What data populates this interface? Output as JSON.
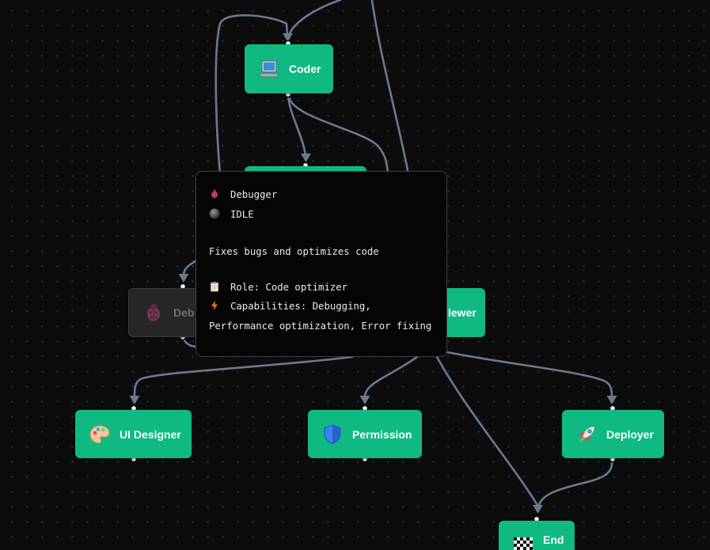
{
  "nodes": {
    "coder": {
      "label": "Coder",
      "icon": "laptop-icon"
    },
    "reviewer": {
      "label": "lewer",
      "icon": "reviewer-icon"
    },
    "debugger": {
      "label": "Deb",
      "icon": "bug-icon"
    },
    "ui_designer": {
      "label": "UI Designer",
      "icon": "palette-icon"
    },
    "permission": {
      "label": "Permission",
      "icon": "shield-icon"
    },
    "deployer": {
      "label": "Deployer",
      "icon": "rocket-icon"
    },
    "end": {
      "label": "End",
      "icon": "checkered-flag-icon"
    }
  },
  "tooltip": {
    "name": "Debugger",
    "status": "IDLE",
    "description": "Fixes bugs and optimizes code",
    "role": "Role: Code optimizer",
    "capabilities": "Capabilities: Debugging, Performance optimization, Error fixing"
  },
  "colors": {
    "node_active": "#10b981",
    "node_idle": "#262626",
    "edge": "#6b7a8f",
    "background": "#0c0c0d"
  }
}
